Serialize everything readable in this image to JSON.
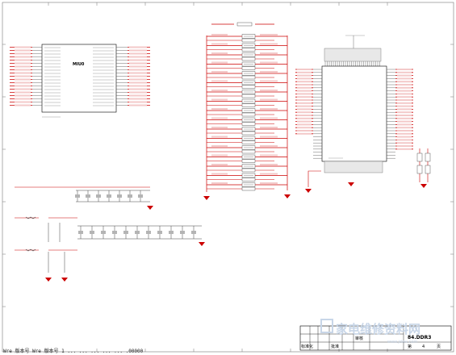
{
  "chip_u1": {
    "label": "MIU0"
  },
  "title_block": {
    "row1": [
      "",
      ""
    ],
    "row2": [
      "审核",
      ""
    ],
    "row3": [
      "标准化",
      "批准"
    ],
    "sheet_name": "84.DDR3",
    "page_label": "第",
    "page_num": "4",
    "page_suffix": "页"
  },
  "footer": {
    "left_text": "Wre  版本号  Wre  版本号  1  ...  ...  ...  ...  ...  .00000"
  },
  "watermark": {
    "text": "家电维修资料网",
    "url": "www.jdwx.com"
  },
  "colors": {
    "wire": "#cc0000",
    "pin": "#4a4a4a",
    "body": "#000000",
    "frame": "#5a5a5a",
    "fill": "#f0f0f0"
  }
}
